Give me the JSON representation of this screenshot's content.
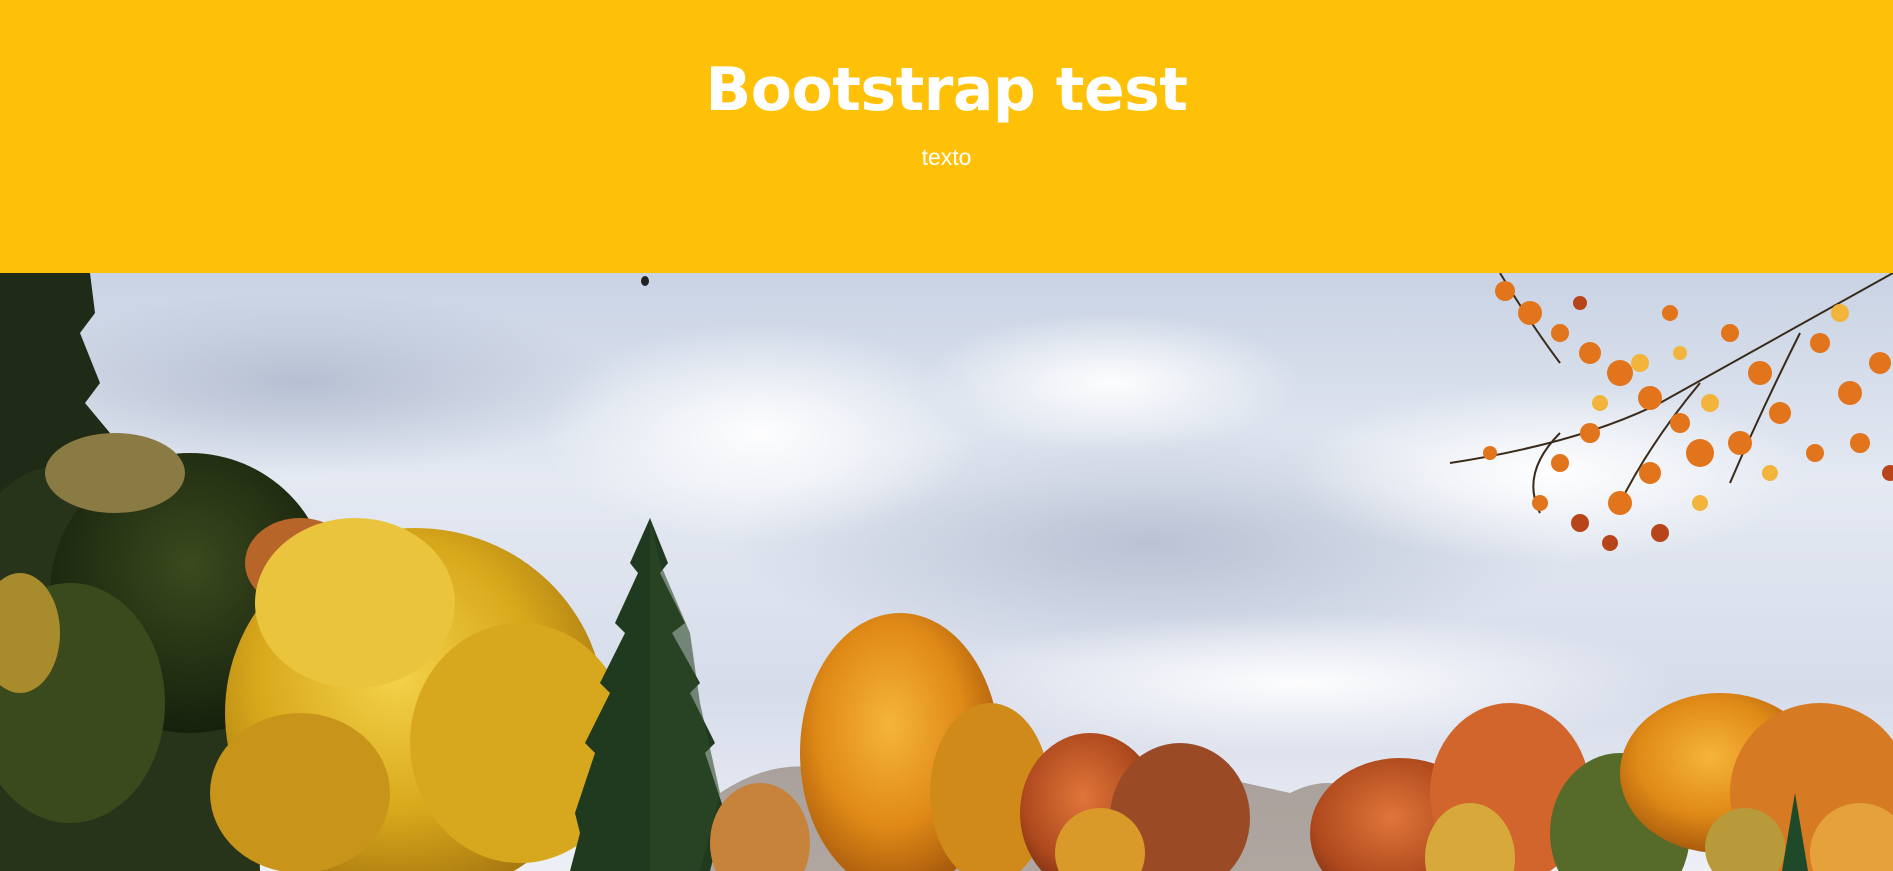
{
  "header": {
    "title": "Bootstrap test",
    "subtitle": "texto",
    "background_color": "#ffc107",
    "text_color": "#ffffff"
  },
  "image": {
    "name": "autumn-trees-photo"
  }
}
